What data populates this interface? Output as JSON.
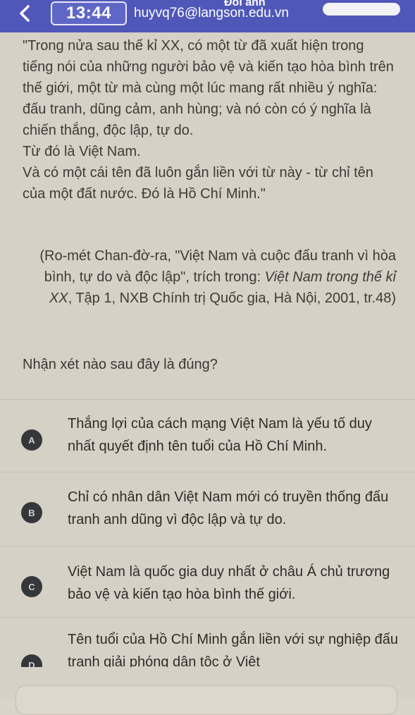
{
  "status_bar": {
    "time": "13:44",
    "email": "huyvq76@langson.edu.vn",
    "title_partial": "Đổi ảnh"
  },
  "passage": {
    "paragraph1": "\"Trong nửa sau thế kỉ XX, có một từ đã xuất hiện trong tiếng nói của những người bảo vệ và kiến tạo hòa bình trên thế giới, một từ mà cùng một lúc mang rất nhiều ý nghĩa: đấu tranh, dũng cảm, anh hùng; và nó còn có ý nghĩa là chiến thắng, độc lập, tự do.",
    "paragraph2": "Từ đó là Việt Nam.",
    "paragraph3": "Và có một cái tên đã luôn gắn liền với từ này - từ chỉ tên của một đất nước. Đó là Hồ Chí Minh.\""
  },
  "citation": {
    "part1": "(Ro-mét Chan-đờ-ra, \"Việt Nam và cuộc đấu tranh vì hòa bình, tự do và độc lập\", trích trong: ",
    "book": "Việt Nam trong thế kỉ XX",
    "part2": ", Tập 1, NXB Chính trị Quốc gia, Hà Nội, 2001, tr.48)"
  },
  "question": "Nhận xét nào sau đây là đúng?",
  "options": [
    {
      "letter": "A",
      "text": "Thắng lợi của cách mạng Việt Nam là yếu tố duy nhất quyết định tên tuổi của Hồ Chí Minh."
    },
    {
      "letter": "B",
      "text": "Chỉ có nhân dân Việt Nam mới có truyền thống đấu tranh anh dũng vì độc lập và tự do."
    },
    {
      "letter": "C",
      "text": "Việt Nam là quốc gia duy nhất ở châu Á chủ trương bảo vệ và kiến tạo hòa bình thế giới."
    },
    {
      "letter": "D",
      "text": "Tên tuổi của Hồ Chí Minh gắn liền với sự nghiệp đấu tranh giải phóng dân tộc ở Việt"
    }
  ],
  "colors": {
    "header": "#4f57b8",
    "background": "#d6d1c6",
    "badge": "#35383b"
  },
  "icons": {
    "back": "chevron-left-icon"
  }
}
